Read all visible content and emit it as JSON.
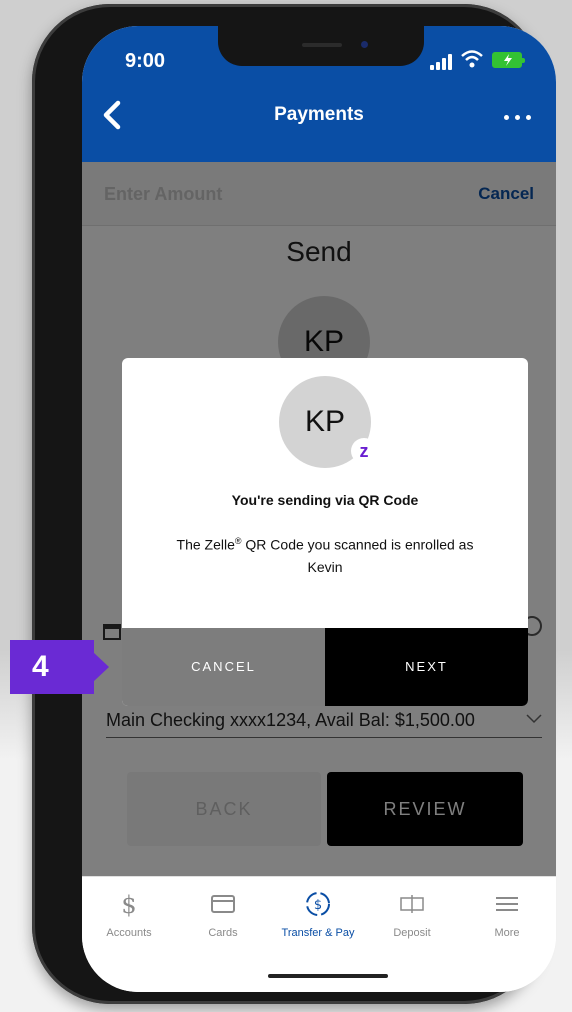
{
  "status_bar": {
    "time": "9:00"
  },
  "header": {
    "title": "Payments",
    "back_icon": "chevron-left-icon",
    "more_icon": "ellipsis-icon"
  },
  "subbar": {
    "amount_label": "Enter Amount",
    "cancel_label": "Cancel"
  },
  "send_form": {
    "title": "Send",
    "recipient_initials": "KP",
    "account_value": "Main Checking xxxx1234, Avail Bal: $1,500.00",
    "back_label": "BACK",
    "review_label": "REVIEW"
  },
  "modal": {
    "initials": "KP",
    "badge_glyph": "z",
    "heading": "You're sending via QR Code",
    "message_before": "The Zelle",
    "message_reg": "®",
    "message_after": " QR Code you scanned is enrolled as",
    "recipient_name": "Kevin",
    "cancel_label": "CANCEL",
    "next_label": "NEXT"
  },
  "tabbar": {
    "items": [
      {
        "label": "Accounts",
        "icon": "dollar-icon"
      },
      {
        "label": "Cards",
        "icon": "card-icon"
      },
      {
        "label": "Transfer & Pay",
        "icon": "transfer-icon"
      },
      {
        "label": "Deposit",
        "icon": "check-deposit-icon"
      },
      {
        "label": "More",
        "icon": "menu-icon"
      }
    ],
    "active_index": 2
  },
  "step_badge": {
    "number": "4"
  },
  "colors": {
    "brand_blue": "#0a4ea5",
    "zelle_purple": "#6a2ad4",
    "battery_green": "#33c233"
  }
}
